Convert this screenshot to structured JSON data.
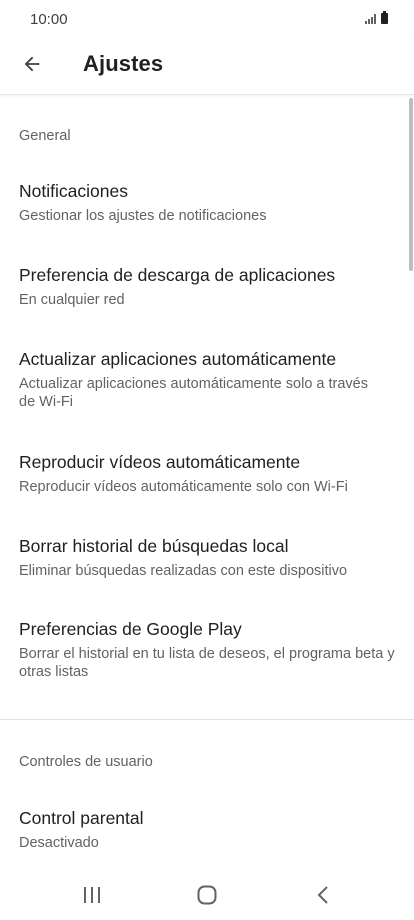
{
  "status_bar": {
    "time": "10:00"
  },
  "app_bar": {
    "title": "Ajustes",
    "back_icon": "arrow-back-icon"
  },
  "sections": {
    "general": {
      "header": "General",
      "items": [
        {
          "title": "Notificaciones",
          "subtitle": "Gestionar los ajustes de notificaciones"
        },
        {
          "title": "Preferencia de descarga de aplicaciones",
          "subtitle": "En cualquier red"
        },
        {
          "title": "Actualizar aplicaciones automáticamente",
          "subtitle": "Actualizar aplicaciones automáticamente solo a través de Wi-Fi"
        },
        {
          "title": "Reproducir vídeos automáticamente",
          "subtitle": "Reproducir vídeos automáticamente solo con Wi-Fi"
        },
        {
          "title": "Borrar historial de búsquedas local",
          "subtitle": "Eliminar búsquedas realizadas con este dispositivo"
        },
        {
          "title": "Preferencias de Google Play",
          "subtitle": "Borrar el historial en tu lista de deseos, el programa beta y otras listas"
        }
      ]
    },
    "user_controls": {
      "header": "Controles de usuario",
      "items": [
        {
          "title": "Control parental",
          "subtitle": "Desactivado"
        }
      ]
    }
  },
  "nav_bar": {
    "icons": [
      "recent-apps-icon",
      "home-icon",
      "back-icon"
    ]
  },
  "colors": {
    "primary_text": "#202124",
    "secondary_text": "#5f6368",
    "divider": "#e0e0e0",
    "background": "#ffffff"
  }
}
